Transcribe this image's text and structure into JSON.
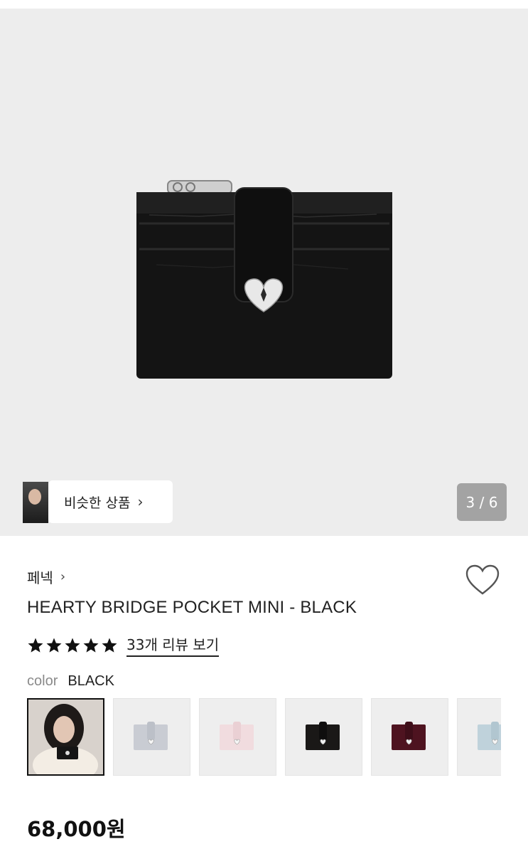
{
  "gallery": {
    "similar_products_label": "비슷한 상품",
    "image_counter": "3 / 6"
  },
  "product": {
    "brand": "페넥",
    "name": "HEARTY BRIDGE POCKET MINI - BLACK",
    "rating_stars": 5,
    "review_link": "33개 리뷰 보기",
    "color_label": "color",
    "color_value": "BLACK",
    "price": "68,000원"
  },
  "swatches": [
    {
      "name": "model-photo",
      "selected": true
    },
    {
      "name": "light-gray",
      "color": "#c9ccd3",
      "selected": false
    },
    {
      "name": "light-pink",
      "color": "#f1dcdf",
      "selected": false
    },
    {
      "name": "black",
      "color": "#1a1817",
      "selected": false
    },
    {
      "name": "burgundy",
      "color": "#4e1320",
      "selected": false
    },
    {
      "name": "light-blue",
      "color": "#bfd2db",
      "selected": false
    }
  ],
  "colors": {
    "hero_background": "#ededed",
    "counter_background": "#a3a3a3",
    "wallet": "#141414"
  }
}
